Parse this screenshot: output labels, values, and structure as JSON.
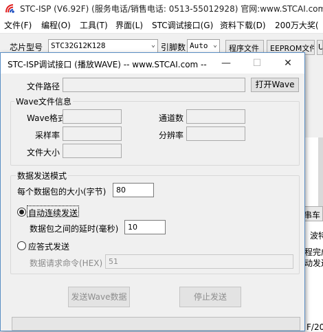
{
  "main_window": {
    "title": "STC-ISP (V6.92F) (服务电话/销售电话: 0513-55012928) 官网:www.STCAI.com",
    "menu": [
      "文件(F)",
      "编程(O)",
      "工具(T)",
      "界面(L)",
      "STC调试接口(G)",
      "资料下载(D)",
      "200万大奖("
    ],
    "toolbar": {
      "chip_label": "芯片型号",
      "chip_value": "STC32G12K128",
      "pins_label": "引脚数",
      "pins_value": "Auto",
      "program_file_button": "程序文件",
      "eeprom_file_button": "EEPROM文件",
      "extra_tab": "U"
    },
    "right_fragments": {
      "tab_cut": "串车",
      "baud_cut": "波特",
      "status_line1": "程完成",
      "status_line2": "动发送",
      "bottom_cut": "F/20"
    }
  },
  "dialog": {
    "title": "STC-ISP调试接口 (播放WAVE) -- www.STCAI.com --",
    "caption_minimize": "—",
    "caption_maximize": "☐",
    "caption_close": "✕",
    "file_path_label": "文件路径",
    "file_path_value": "",
    "open_wave_button": "打开Wave",
    "wave_info": {
      "group_title": "Wave文件信息",
      "format_label": "Wave格式",
      "format_value": "",
      "channels_label": "通道数",
      "channels_value": "",
      "sample_rate_label": "采样率",
      "sample_rate_value": "",
      "resolution_label": "分辨率",
      "resolution_value": "",
      "file_size_label": "文件大小",
      "file_size_value": ""
    },
    "send_mode": {
      "group_title": "数据发送模式",
      "packet_size_label": "每个数据包的大小(字节)",
      "packet_size_value": "80",
      "auto_label": "自动连续发送",
      "auto_selected": true,
      "delay_label": "数据包之间的延时(毫秒)",
      "delay_value": "10",
      "reply_label": "应答式发送",
      "reply_selected": false,
      "request_cmd_label": "数据请求命令(HEX)",
      "request_cmd_value": "51"
    },
    "send_button": "发送Wave数据",
    "stop_button": "停止发送",
    "progress_fraction": 0.0
  },
  "colors": {
    "dialog_border": "#5a8ec4",
    "app_logo_red": "#e02020",
    "app_logo_blue": "#2050c0"
  }
}
